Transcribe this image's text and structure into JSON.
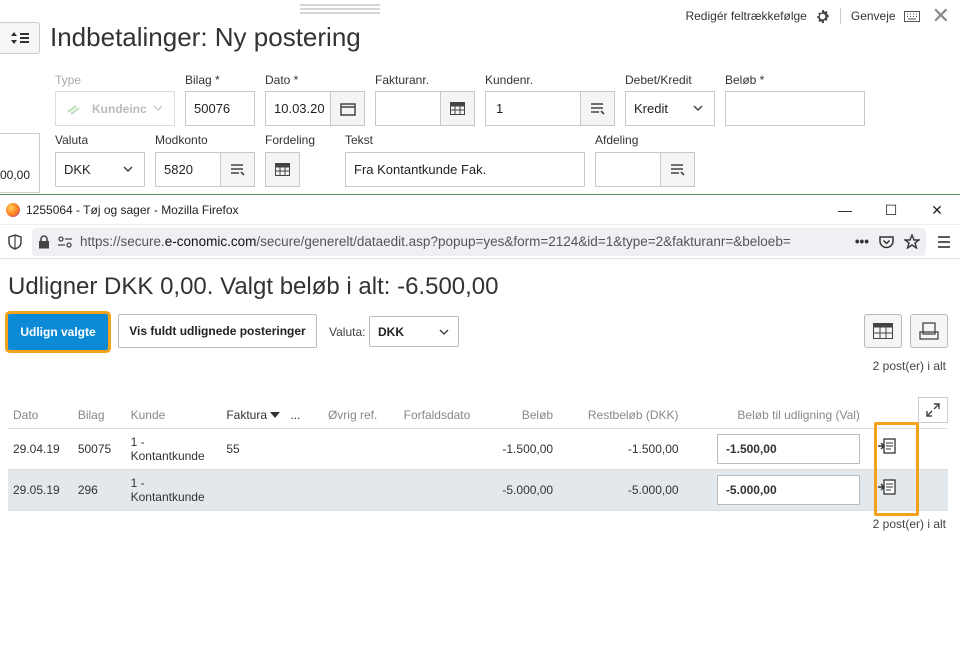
{
  "bg": {
    "title": "Indbetalinger: Ny postering",
    "toolbar": {
      "reorder": "Redigér feltrækkefølge",
      "shortcuts": "Genveje"
    },
    "fields": {
      "type_label": "Type",
      "type_value": "Kundeinc",
      "bilag_label": "Bilag *",
      "bilag_value": "50076",
      "dato_label": "Dato *",
      "dato_value": "10.03.20",
      "faktura_label": "Fakturanr.",
      "faktura_value": "",
      "kunde_label": "Kundenr.",
      "kunde_value": "1",
      "debet_label": "Debet/Kredit",
      "debet_value": "Kredit",
      "belob_label": "Beløb *",
      "belob_value": "",
      "valuta_label": "Valuta",
      "valuta_value": "DKK",
      "modkonto_label": "Modkonto",
      "modkonto_value": "5820",
      "fordeling_label": "Fordeling",
      "tekst_label": "Tekst",
      "tekst_value": "Fra Kontantkunde Fak.",
      "afdeling_label": "Afdeling",
      "afdeling_value": ""
    },
    "side_value": "00,00"
  },
  "popup": {
    "window_title": "1255064 - Tøj og sager - Mozilla Firefox",
    "url_prefix": "https://secure.",
    "url_host": "e-conomic.com",
    "url_path": "/secure/generelt/dataedit.asp?popup=yes&form=2124&id=1&type=2&fakturanr=&beloeb=",
    "heading": "Udligner DKK 0,00. Valgt beløb i alt: -6.500,00",
    "btn_udlign": "Udlign valgte",
    "btn_vis": "Vis fuldt udlignede posteringer",
    "valuta_label": "Valuta:",
    "valuta_value": "DKK",
    "count_text": "2 post(er) i alt",
    "columns": [
      "Dato",
      "Bilag",
      "Kunde",
      "Faktura",
      "...",
      "Øvrig ref.",
      "Forfaldsdato",
      "Beløb",
      "Restbeløb (DKK)",
      "Beløb til udligning (Val)"
    ],
    "rows": [
      {
        "dato": "29.04.19",
        "bilag": "50075",
        "kunde": "1 - Kontantkunde",
        "faktura": "55",
        "ovrig": "",
        "forfald": "",
        "belob": "-1.500,00",
        "rest": "-1.500,00",
        "udl": "-1.500,00"
      },
      {
        "dato": "29.05.19",
        "bilag": "296",
        "kunde": "1 - Kontantkunde",
        "faktura": "",
        "ovrig": "",
        "forfald": "",
        "belob": "-5.000,00",
        "rest": "-5.000,00",
        "udl": "-5.000,00"
      }
    ]
  },
  "colors": {
    "primary": "#0d8ad6",
    "highlight": "#f3a21b",
    "alt_row": "#e3e8ec"
  }
}
